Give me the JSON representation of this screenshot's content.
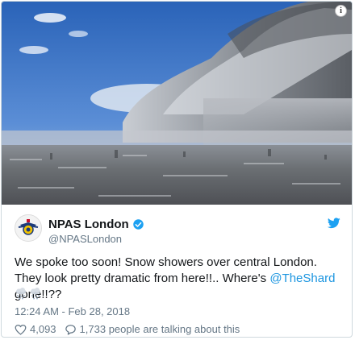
{
  "photo": {
    "alt_label": "Snow shower cloud over London skyline"
  },
  "info_icon": "i",
  "author": {
    "display_name": "NPAS London",
    "handle": "@NPASLondon"
  },
  "tweet": {
    "text_part1": "We spoke too soon!  Snow showers over central London. They look pretty dramatic from here!!.. Where's ",
    "mention": "@TheShard",
    "text_part2": " gone!!??",
    "emojis": [
      "cloud-with-snow",
      "cloud-with-snow"
    ],
    "timestamp": "12:24 AM - Feb 28, 2018"
  },
  "stats": {
    "likes": "4,093",
    "talking": "1,733 people are talking about this"
  },
  "colors": {
    "link": "#1b95e0",
    "verified": "#1da1f2",
    "secondary_text": "#657786"
  }
}
